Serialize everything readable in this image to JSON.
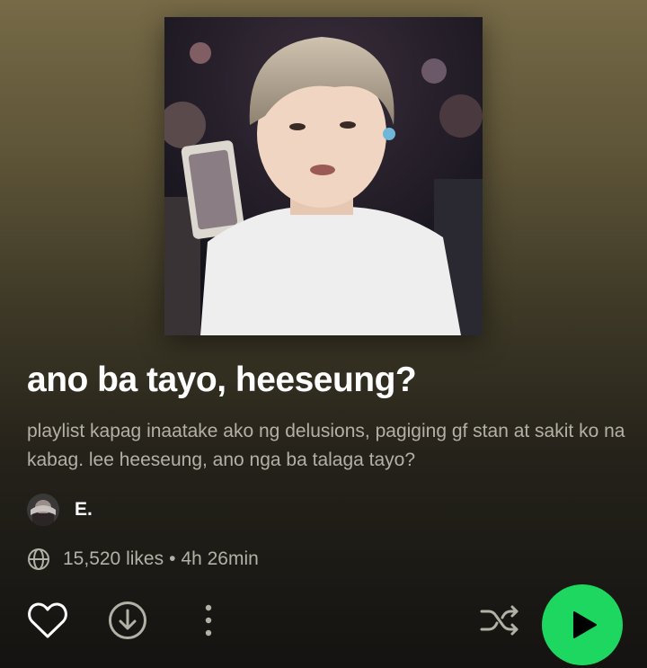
{
  "playlist": {
    "title": "ano ba tayo, heeseung?",
    "description": "playlist kapag inaatake ako ng delusions, pagiging gf stan at sakit ko na kabag. lee heeseung, ano nga ba talaga tayo?",
    "owner_name": "E.",
    "likes": "15,520 likes",
    "separator": "•",
    "duration": "4h 26min"
  },
  "icons": {
    "cover": "playlist-cover-photo",
    "avatar": "owner-avatar",
    "visibility": "globe-icon",
    "like": "heart-outline-icon",
    "download": "download-circle-icon",
    "more": "more-vertical-icon",
    "shuffle": "shuffle-icon",
    "play": "play-icon"
  },
  "colors": {
    "accent": "#1ed760",
    "text_secondary": "#b3b0a6",
    "background_top": "#766a47",
    "background_bottom": "#141311"
  }
}
